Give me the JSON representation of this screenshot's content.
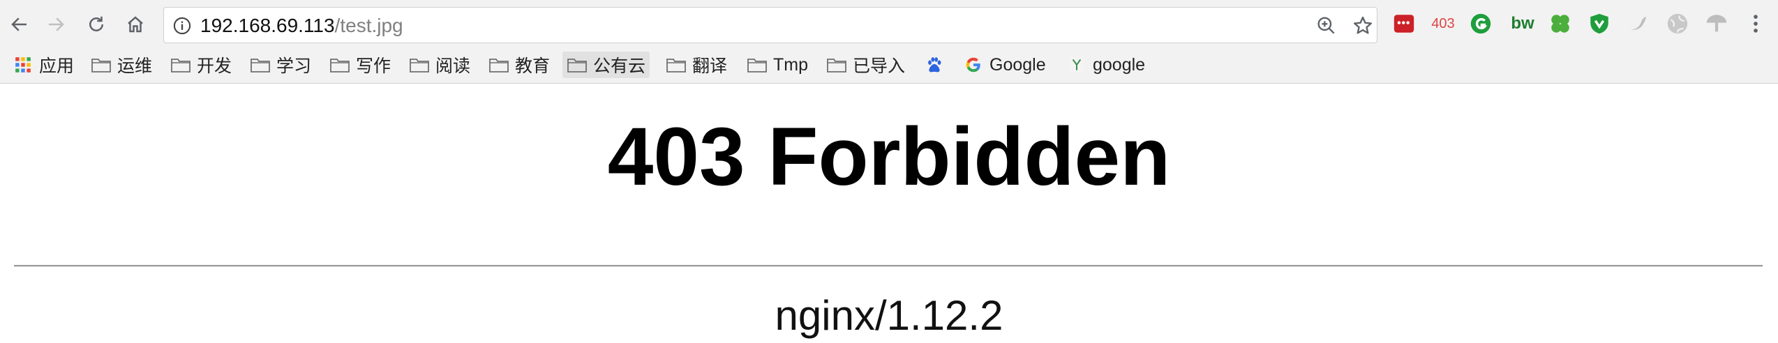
{
  "browser": {
    "url_host": "192.168.69.113",
    "url_path": "/test.jpg",
    "extensions": [
      {
        "name": "lastpass-extension-icon"
      },
      {
        "name": "http-status-extension-icon",
        "label": "403"
      },
      {
        "name": "grammarly-extension-icon"
      },
      {
        "name": "bw-extension-icon",
        "label": "bw"
      },
      {
        "name": "clover-extension-icon"
      },
      {
        "name": "shield-extension-icon"
      },
      {
        "name": "bird-extension-icon"
      },
      {
        "name": "globe-extension-icon"
      },
      {
        "name": "mushroom-extension-icon"
      }
    ]
  },
  "bookmarks": [
    {
      "label": "应用",
      "icon": "apps-grid-icon"
    },
    {
      "label": "运维",
      "icon": "folder-icon"
    },
    {
      "label": "开发",
      "icon": "folder-icon"
    },
    {
      "label": "学习",
      "icon": "folder-icon"
    },
    {
      "label": "写作",
      "icon": "folder-icon"
    },
    {
      "label": "阅读",
      "icon": "folder-icon"
    },
    {
      "label": "教育",
      "icon": "folder-icon"
    },
    {
      "label": "公有云",
      "icon": "folder-icon",
      "active": true
    },
    {
      "label": "翻译",
      "icon": "folder-icon"
    },
    {
      "label": "Tmp",
      "icon": "folder-icon"
    },
    {
      "label": "已导入",
      "icon": "folder-icon"
    },
    {
      "label": "",
      "icon": "baidu-paw-icon"
    },
    {
      "label": "Google",
      "icon": "google-g-icon"
    },
    {
      "label": "google",
      "icon": "y-favicon-icon"
    }
  ],
  "page": {
    "heading": "403 Forbidden",
    "server": "nginx/1.12.2"
  },
  "colors": {
    "toolbar_bg": "#f2f2f2",
    "ext_403_red": "#d44444",
    "ext_green": "#1e9e3c",
    "lastpass_red": "#cc2128"
  }
}
